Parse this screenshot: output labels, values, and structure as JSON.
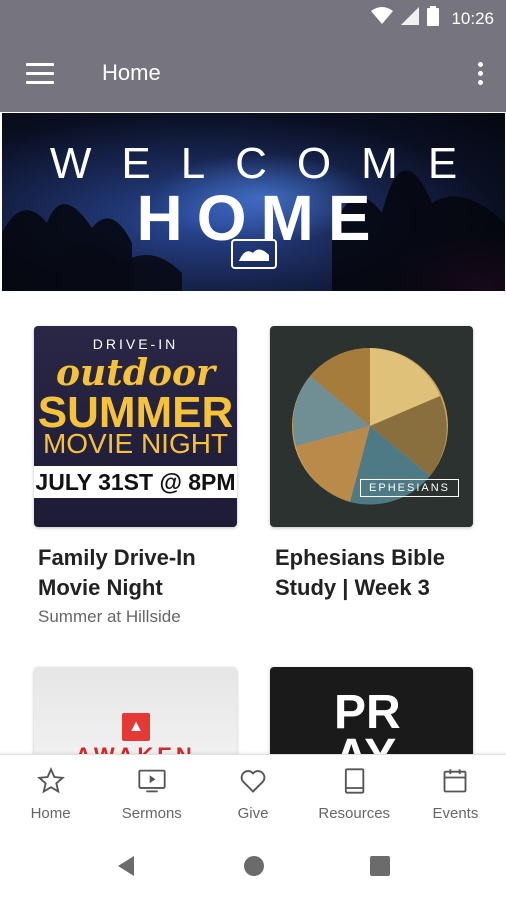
{
  "status_bar": {
    "time": "10:26",
    "icons": [
      "wifi-icon",
      "signal-icon",
      "battery-icon"
    ]
  },
  "app_bar": {
    "title": "Home",
    "icons": [
      "menu-icon",
      "more-vert-icon"
    ]
  },
  "hero": {
    "welcome_text": "WELCOME",
    "home_text": "HOME"
  },
  "cards": [
    {
      "title": "Family Drive-In Movie Night",
      "subtitle": "Summer at Hillside",
      "image": {
        "line1": "DRIVE-IN",
        "line2": "outdoor",
        "line3": "SUMMER",
        "line4": "MOVIE NIGHT",
        "line5": "JULY 31ST @ 8PM"
      }
    },
    {
      "title": "Ephesians Bible Study | Week 3",
      "subtitle": "",
      "image": {
        "label": "EPHESIANS"
      }
    },
    {
      "title": "",
      "subtitle": "",
      "image": {
        "label": "AWAKEN"
      }
    },
    {
      "title": "",
      "subtitle": "",
      "image": {
        "label": "PR\nAY"
      }
    }
  ],
  "bottom_nav": [
    {
      "label": "Home",
      "icon": "star-icon"
    },
    {
      "label": "Sermons",
      "icon": "play-screen-icon"
    },
    {
      "label": "Give",
      "icon": "heart-icon"
    },
    {
      "label": "Resources",
      "icon": "book-icon"
    },
    {
      "label": "Events",
      "icon": "calendar-icon"
    }
  ],
  "system_nav": [
    "back-icon",
    "home-circle-icon",
    "recents-icon"
  ],
  "colors": {
    "app_bar": "#76757f",
    "accent_yellow": "#f6c23a",
    "text_dark": "#222222",
    "text_muted": "#666666"
  }
}
